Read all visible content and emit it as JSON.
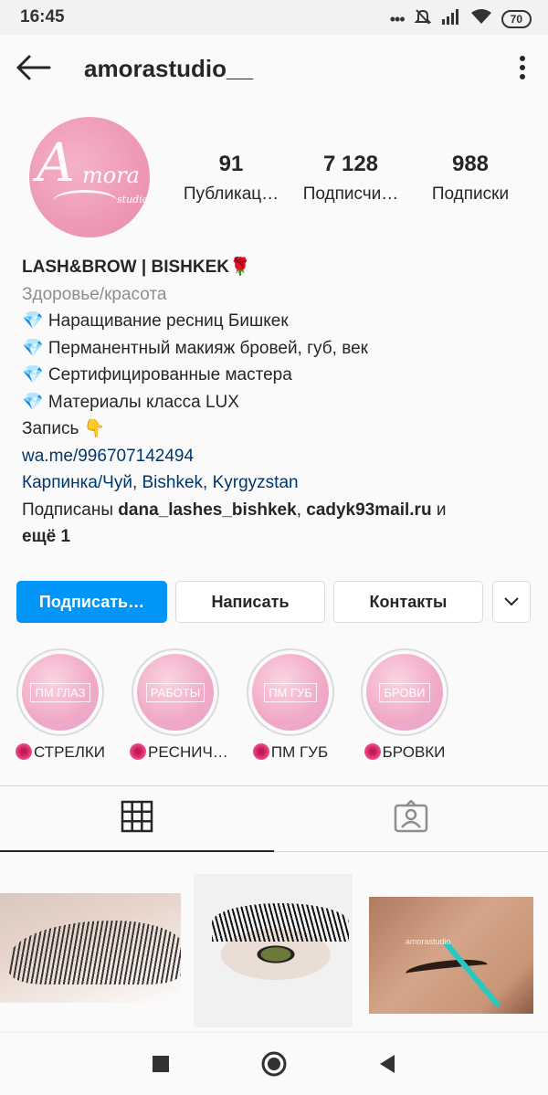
{
  "status_bar": {
    "time": "16:45",
    "dots": "•••",
    "battery": "70"
  },
  "header": {
    "username": "amorastudio__"
  },
  "profile": {
    "avatar_text": {
      "big": "A",
      "mid": "mora",
      "small": "studio"
    },
    "stats": [
      {
        "value": "91",
        "label": "Публикац…"
      },
      {
        "value": "7 128",
        "label": "Подписчи…"
      },
      {
        "value": "988",
        "label": "Подписки"
      }
    ]
  },
  "bio": {
    "name": "LASH&BROW | BISHKEK🌹",
    "category": "Здоровье/красота",
    "lines": [
      "💎 Наращивание ресниц Бишкек",
      "💎 Перманентный макияж бровей, губ, век",
      "💎 Сертифицированные мастера",
      "💎 Материалы класса LUX",
      "Запись 👇"
    ],
    "link": "wa.me/996707142494",
    "location": "Карпинка/Чуй, Bishkek, Kyrgyzstan",
    "followed_prefix": "Подписаны ",
    "followed_user1": "dana_lashes_bishkek",
    "followed_sep": ", ",
    "followed_user2": "cadyk93mail.ru",
    "followed_and": " и ",
    "followed_more": "ещё 1"
  },
  "buttons": {
    "follow": "Подписать…",
    "message": "Написать",
    "contacts": "Контакты"
  },
  "highlights": [
    {
      "cover": "ПМ ГЛАЗ",
      "label": "СТРЕЛКИ"
    },
    {
      "cover": "РАБОТЫ",
      "label": "РЕСНИЧ…"
    },
    {
      "cover": "ПМ ГУБ",
      "label": "ПМ ГУБ"
    },
    {
      "cover": "БРОВИ",
      "label": "БРОВКИ"
    }
  ],
  "posts": [
    {
      "subject": "lash-extension-closeup"
    },
    {
      "subject": "eye-with-lashes"
    },
    {
      "subject": "brow-tint",
      "watermark": "amorastudio"
    }
  ],
  "colors": {
    "accent": "#0095f6",
    "link": "#00376b",
    "secondary": "#8e8e8e"
  }
}
